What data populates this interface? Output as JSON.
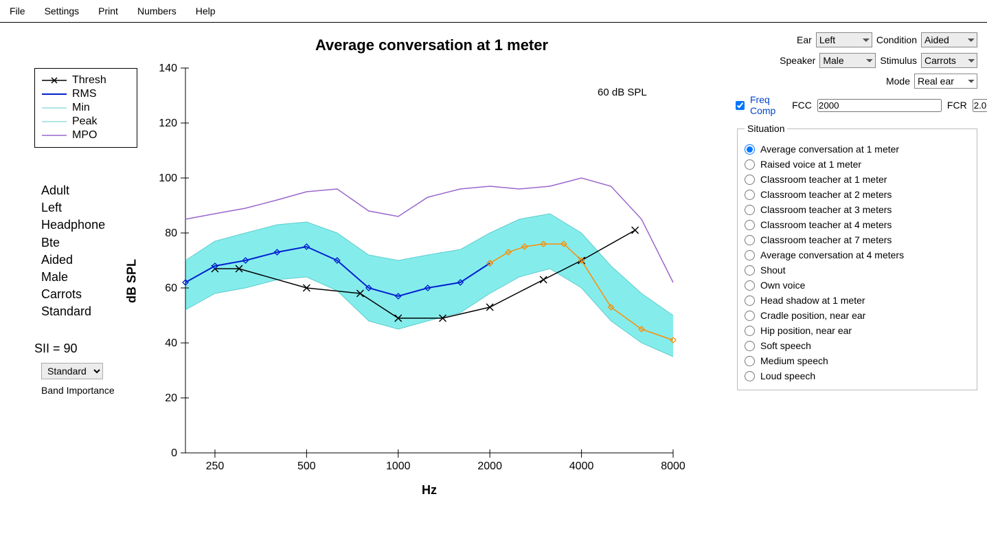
{
  "menu": [
    "File",
    "Settings",
    "Print",
    "Numbers",
    "Help"
  ],
  "chart_title": "Average conversation at 1 meter",
  "legend": [
    {
      "label": "Thresh",
      "color": "#000000",
      "style": "x"
    },
    {
      "label": "RMS",
      "color": "#0020d0",
      "style": "line"
    },
    {
      "label": "Min",
      "color": "#5fcccc",
      "style": "thin"
    },
    {
      "label": "Peak",
      "color": "#5fcccc",
      "style": "thin"
    },
    {
      "label": "MPO",
      "color": "#9966cc",
      "style": "line"
    }
  ],
  "info": [
    "Adult",
    "Left",
    "Headphone",
    "Bte",
    "Aided",
    "Male",
    "Carrots",
    "Standard"
  ],
  "sii": {
    "prefix": "SII = ",
    "value": "90"
  },
  "band_importance": {
    "selected": "Standard",
    "label": "Band Importance"
  },
  "annotation": "60 dB SPL",
  "controls": {
    "ear": {
      "label": "Ear",
      "value": "Left"
    },
    "condition": {
      "label": "Condition",
      "value": "Aided"
    },
    "speaker": {
      "label": "Speaker",
      "value": "Male"
    },
    "stimulus": {
      "label": "Stimulus",
      "value": "Carrots"
    },
    "mode": {
      "label": "Mode",
      "value": "Real ear"
    },
    "freq_comp": {
      "checked": true,
      "label": "Freq Comp"
    },
    "fcc": {
      "label": "FCC",
      "value": "2000"
    },
    "fcr": {
      "label": "FCR",
      "value": "2.0"
    }
  },
  "situation": {
    "legend": "Situation",
    "options": [
      "Average conversation at 1 meter",
      "Raised voice at 1 meter",
      "Classroom teacher at 1 meter",
      "Classroom teacher at 2 meters",
      "Classroom teacher at 3 meters",
      "Classroom teacher at 4 meters",
      "Classroom teacher at 7 meters",
      "Average conversation at 4 meters",
      "Shout",
      "Own voice",
      "Head shadow at 1 meter",
      "Cradle position, near ear",
      "Hip position, near ear",
      "Soft speech",
      "Medium speech",
      "Loud speech"
    ],
    "selected": 0
  },
  "chart_data": {
    "type": "line",
    "title": "Average conversation at 1 meter",
    "xlabel": "Hz",
    "ylabel": "dB SPL",
    "xscale": "log",
    "xlim": [
      200,
      8000
    ],
    "ylim": [
      0,
      140
    ],
    "xticks": [
      250,
      500,
      1000,
      2000,
      4000,
      8000
    ],
    "yticks": [
      0,
      20,
      40,
      60,
      80,
      100,
      120,
      140
    ],
    "annotation": "60 dB SPL",
    "series": [
      {
        "name": "Thresh",
        "color": "#000000",
        "marker": "x",
        "x": [
          250,
          300,
          500,
          750,
          1000,
          1400,
          2000,
          3000,
          4000,
          6000
        ],
        "y": [
          67,
          67,
          60,
          58,
          49,
          49,
          53,
          63,
          70,
          81
        ]
      },
      {
        "name": "RMS",
        "color": "#0020d0",
        "marker": "diamond",
        "x": [
          200,
          250,
          315,
          400,
          500,
          630,
          800,
          1000,
          1250,
          1600,
          2000
        ],
        "y": [
          62,
          68,
          70,
          73,
          75,
          70,
          60,
          57,
          60,
          62,
          69
        ]
      },
      {
        "name": "RMS_comp",
        "color": "#ff8c00",
        "marker": "diamond",
        "x": [
          2000,
          2300,
          2600,
          3000,
          3500,
          4000,
          5000,
          6300,
          8000
        ],
        "y": [
          69,
          73,
          75,
          76,
          76,
          70,
          53,
          45,
          41
        ]
      },
      {
        "name": "Min",
        "color": "#5fcccc",
        "x": [
          200,
          250,
          315,
          400,
          500,
          630,
          800,
          1000,
          1250,
          1600,
          2000,
          2500,
          3150,
          4000,
          5000,
          6300,
          8000
        ],
        "y": [
          52,
          58,
          60,
          63,
          64,
          59,
          48,
          45,
          48,
          51,
          58,
          64,
          67,
          60,
          48,
          40,
          35
        ]
      },
      {
        "name": "Peak",
        "color": "#5fcccc",
        "x": [
          200,
          250,
          315,
          400,
          500,
          630,
          800,
          1000,
          1250,
          1600,
          2000,
          2500,
          3150,
          4000,
          5000,
          6300,
          8000
        ],
        "y": [
          70,
          77,
          80,
          83,
          84,
          80,
          72,
          70,
          72,
          74,
          80,
          85,
          87,
          80,
          68,
          58,
          50
        ]
      },
      {
        "name": "MPO",
        "color": "#9966cc",
        "x": [
          200,
          250,
          315,
          400,
          500,
          630,
          800,
          1000,
          1250,
          1600,
          2000,
          2500,
          3150,
          4000,
          5000,
          6300,
          8000
        ],
        "y": [
          85,
          87,
          89,
          92,
          95,
          96,
          88,
          86,
          93,
          96,
          97,
          96,
          97,
          100,
          97,
          85,
          62
        ]
      }
    ]
  }
}
